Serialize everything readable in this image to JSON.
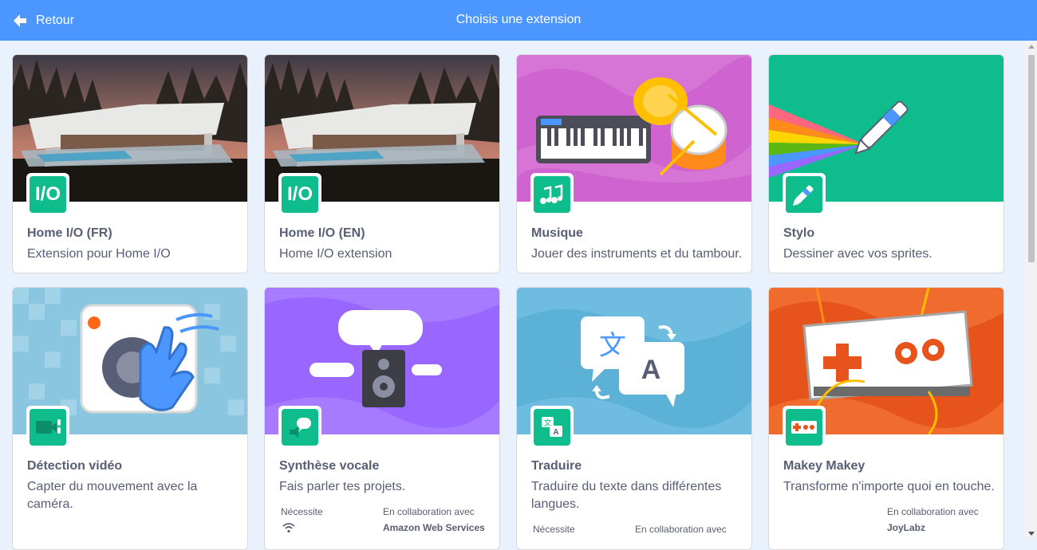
{
  "header": {
    "back_label": "Retour",
    "title": "Choisis une extension"
  },
  "extensions": [
    {
      "name": "Home I/O (FR)",
      "description": "Extension pour Home I/O",
      "badge": "I/O"
    },
    {
      "name": "Home I/O (EN)",
      "description": "Home I/O extension",
      "badge": "I/O"
    },
    {
      "name": "Musique",
      "description": "Jouer des instruments et du tambour.",
      "badge_icon": "music-notes-icon"
    },
    {
      "name": "Stylo",
      "description": "Dessiner avec vos sprites.",
      "badge_icon": "pen-icon"
    },
    {
      "name": "Détection vidéo",
      "description": "Capter du mouvement avec la caméra.",
      "badge_icon": "video-camera-icon"
    },
    {
      "name": "Synthèse vocale",
      "description": "Fais parler tes projets.",
      "badge_icon": "speech-icon",
      "requires_label": "Nécessite",
      "requires_icon": "wifi-icon",
      "collab_label": "En collaboration avec",
      "collab_partner": "Amazon Web Services"
    },
    {
      "name": "Traduire",
      "description": "Traduire du texte dans différentes langues.",
      "badge_icon": "translate-icon",
      "requires_label": "Nécessite",
      "collab_label": "En collaboration avec"
    },
    {
      "name": "Makey Makey",
      "description": "Transforme n'importe quoi en touche.",
      "badge_icon": "makey-makey-icon",
      "collab_label": "En collaboration avec",
      "collab_partner": "JoyLabz"
    }
  ],
  "colors": {
    "header": "#4c97ff",
    "badge": "#0fbd8c",
    "text": "#575e75",
    "background": "#e9f1fc"
  }
}
